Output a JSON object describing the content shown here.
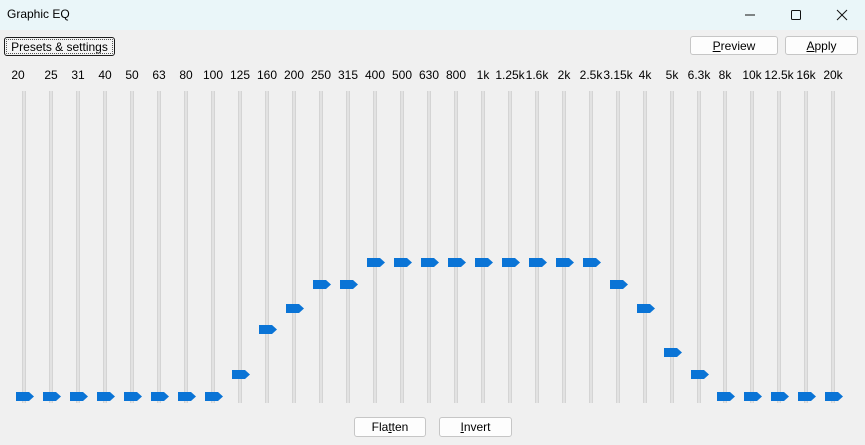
{
  "window": {
    "title": "Graphic EQ"
  },
  "toolbar": {
    "presets_label": "Presets & settings",
    "preview_label": "Preview",
    "preview_mnemonic": "P",
    "preview_rest": "review",
    "apply_label": "Apply",
    "apply_mnemonic": "A",
    "apply_rest": "pply"
  },
  "footer": {
    "flatten_pre": "Fla",
    "flatten_mnemonic": "t",
    "flatten_post": "ten",
    "invert_mnemonic": "I",
    "invert_rest": "nvert"
  },
  "colors": {
    "thumb": "#0a74d6",
    "track": "#e2e2e2",
    "titlebar": "#eaf6f9"
  },
  "slider_range_db": [
    -12,
    12
  ],
  "bands": [
    {
      "freq": "20",
      "gain_db": -12
    },
    {
      "freq": "25",
      "gain_db": -12
    },
    {
      "freq": "31",
      "gain_db": -12
    },
    {
      "freq": "40",
      "gain_db": -12
    },
    {
      "freq": "50",
      "gain_db": -12
    },
    {
      "freq": "63",
      "gain_db": -12
    },
    {
      "freq": "80",
      "gain_db": -12
    },
    {
      "freq": "100",
      "gain_db": -12
    },
    {
      "freq": "125",
      "gain_db": -10.3
    },
    {
      "freq": "160",
      "gain_db": -6.8
    },
    {
      "freq": "200",
      "gain_db": -5.1
    },
    {
      "freq": "250",
      "gain_db": -3.2
    },
    {
      "freq": "315",
      "gain_db": -3.2
    },
    {
      "freq": "400",
      "gain_db": -1.5
    },
    {
      "freq": "500",
      "gain_db": -1.5
    },
    {
      "freq": "630",
      "gain_db": -1.5
    },
    {
      "freq": "800",
      "gain_db": -1.5
    },
    {
      "freq": "1k",
      "gain_db": -1.5
    },
    {
      "freq": "1.25k",
      "gain_db": -1.5
    },
    {
      "freq": "1.6k",
      "gain_db": -1.5
    },
    {
      "freq": "2k",
      "gain_db": -1.5
    },
    {
      "freq": "2.5k",
      "gain_db": -1.5
    },
    {
      "freq": "3.15k",
      "gain_db": -3.2
    },
    {
      "freq": "4k",
      "gain_db": -5.1
    },
    {
      "freq": "5k",
      "gain_db": -8.6
    },
    {
      "freq": "6.3k",
      "gain_db": -10.3
    },
    {
      "freq": "8k",
      "gain_db": -12
    },
    {
      "freq": "10k",
      "gain_db": -12
    },
    {
      "freq": "12.5k",
      "gain_db": -12
    },
    {
      "freq": "16k",
      "gain_db": -12
    },
    {
      "freq": "20k",
      "gain_db": -12
    }
  ]
}
